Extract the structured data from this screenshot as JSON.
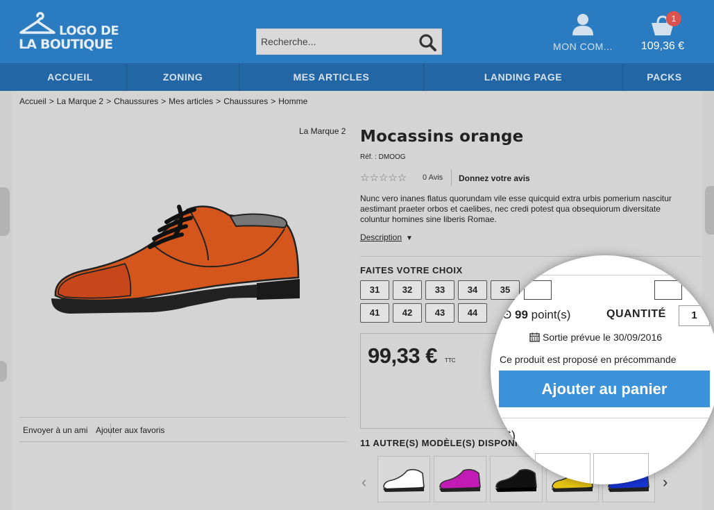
{
  "header": {
    "logo_line1": "LOGO DE",
    "logo_line2": "LA BOUTIQUE",
    "search_placeholder": "Recherche...",
    "account_label": "MON COM...",
    "cart_count": "1",
    "cart_total": "109,36 €"
  },
  "nav": {
    "items": [
      {
        "label": "ACCUEIL"
      },
      {
        "label": "ZONING"
      },
      {
        "label": "MES ARTICLES"
      },
      {
        "label": "LANDING PAGE"
      },
      {
        "label": "PACKS"
      }
    ]
  },
  "breadcrumb": [
    "Accueil",
    "La Marque 2",
    "Chaussures",
    "Mes articles",
    "Chaussures",
    "Homme"
  ],
  "breadcrumb_sep": ">",
  "product": {
    "brand": "La Marque 2",
    "title": "Mocassins orange",
    "ref": "Réf. : DMOOG",
    "stars": "☆☆☆☆☆",
    "rating": 0,
    "reviews_count": "0 Avis",
    "give_review": "Donnez votre avis",
    "description": "Nunc vero inanes flatus quorundam vile esse quicquid extra urbis pomerium nascitur aestimant praeter orbos et caelibes, nec credi potest qua obsequiorum diversitate coluntur homines sine liberis Romae.",
    "description_link": "Description",
    "choice_label": "FAITES VOTRE CHOIX",
    "sizes_row1": [
      "31",
      "32",
      "33",
      "34",
      "35"
    ],
    "sizes_row2": [
      "41",
      "42",
      "43",
      "44"
    ],
    "price": "99,33 €",
    "price_suffix": "TTC",
    "send_friend": "Envoyer à un ami",
    "add_favorites": "Ajouter aux favoris",
    "other_models": "11 AUTRE(S) MODÈLE(S) DISPONI",
    "other_models_tail": "S)"
  },
  "magnifier": {
    "points_value": "99",
    "points_label": "point(s)",
    "points_prefix": "Ͽ",
    "quantity_label": "QUANTITÉ",
    "quantity_value": "1",
    "release": "Sortie prévue le 30/09/2016",
    "preorder": "Ce produit est proposé en précommande",
    "add_to_cart": "Ajouter au panier"
  },
  "colors": {
    "header_blue": "#2b7bc0",
    "nav_blue": "#2266a6",
    "button_blue": "#3b92d8",
    "badge_red": "#d9534f",
    "shoe_orange": "#d4561c"
  },
  "thumbnails": [
    {
      "color": "#ffffff"
    },
    {
      "color": "#c11ab5"
    },
    {
      "color": "#111111"
    },
    {
      "color": "#e6c414"
    },
    {
      "color": "#1836d6"
    }
  ]
}
